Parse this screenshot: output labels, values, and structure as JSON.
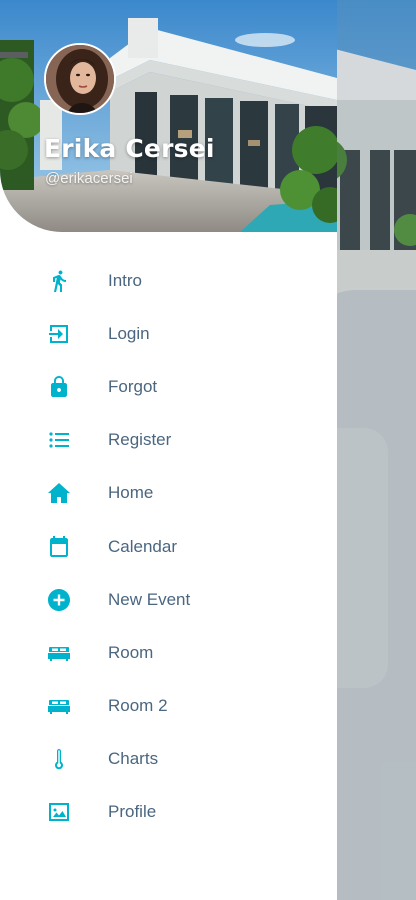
{
  "user": {
    "name": "Erika Cersei",
    "handle": "@erikacersei"
  },
  "colors": {
    "accent": "#00b3cc",
    "label": "#4a6680",
    "overlay": "#aeb8bd"
  },
  "menu": {
    "items": [
      {
        "label": "Intro",
        "icon": "walking-person-icon"
      },
      {
        "label": "Login",
        "icon": "login-icon"
      },
      {
        "label": "Forgot",
        "icon": "lock-icon"
      },
      {
        "label": "Register",
        "icon": "list-icon"
      },
      {
        "label": "Home",
        "icon": "home-icon"
      },
      {
        "label": "Calendar",
        "icon": "calendar-icon"
      },
      {
        "label": "New Event",
        "icon": "add-circle-icon"
      },
      {
        "label": "Room",
        "icon": "bed-icon"
      },
      {
        "label": "Room 2",
        "icon": "bed-icon"
      },
      {
        "label": "Charts",
        "icon": "thermometer-icon"
      },
      {
        "label": "Profile",
        "icon": "image-icon"
      }
    ]
  }
}
